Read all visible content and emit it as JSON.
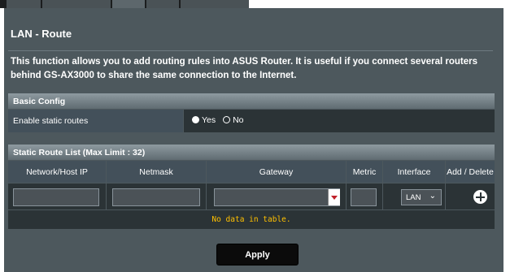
{
  "page": {
    "title": "LAN - Route",
    "description": "This function allows you to add routing rules into ASUS Router. It is useful if you connect several routers behind GS-AX3000 to share the same connection to the Internet."
  },
  "basic_config": {
    "header": "Basic Config",
    "enable_label": "Enable static routes",
    "options": [
      "Yes",
      "No"
    ],
    "selected": "Yes"
  },
  "route_list": {
    "header": "Static Route List (Max Limit : 32)",
    "columns": [
      "Network/Host IP",
      "Netmask",
      "Gateway",
      "Metric",
      "Interface",
      "Add / Delete"
    ],
    "interface_value": "LAN",
    "empty_message": "No data in table."
  },
  "actions": {
    "apply_label": "Apply"
  },
  "colors": {
    "panel": "#4d585d",
    "empty_text": "#ffc000",
    "dropdown_arrow": "#c0202a"
  },
  "icons": {
    "add": "plus-circle-icon",
    "dropdown": "chevron-down-icon"
  }
}
